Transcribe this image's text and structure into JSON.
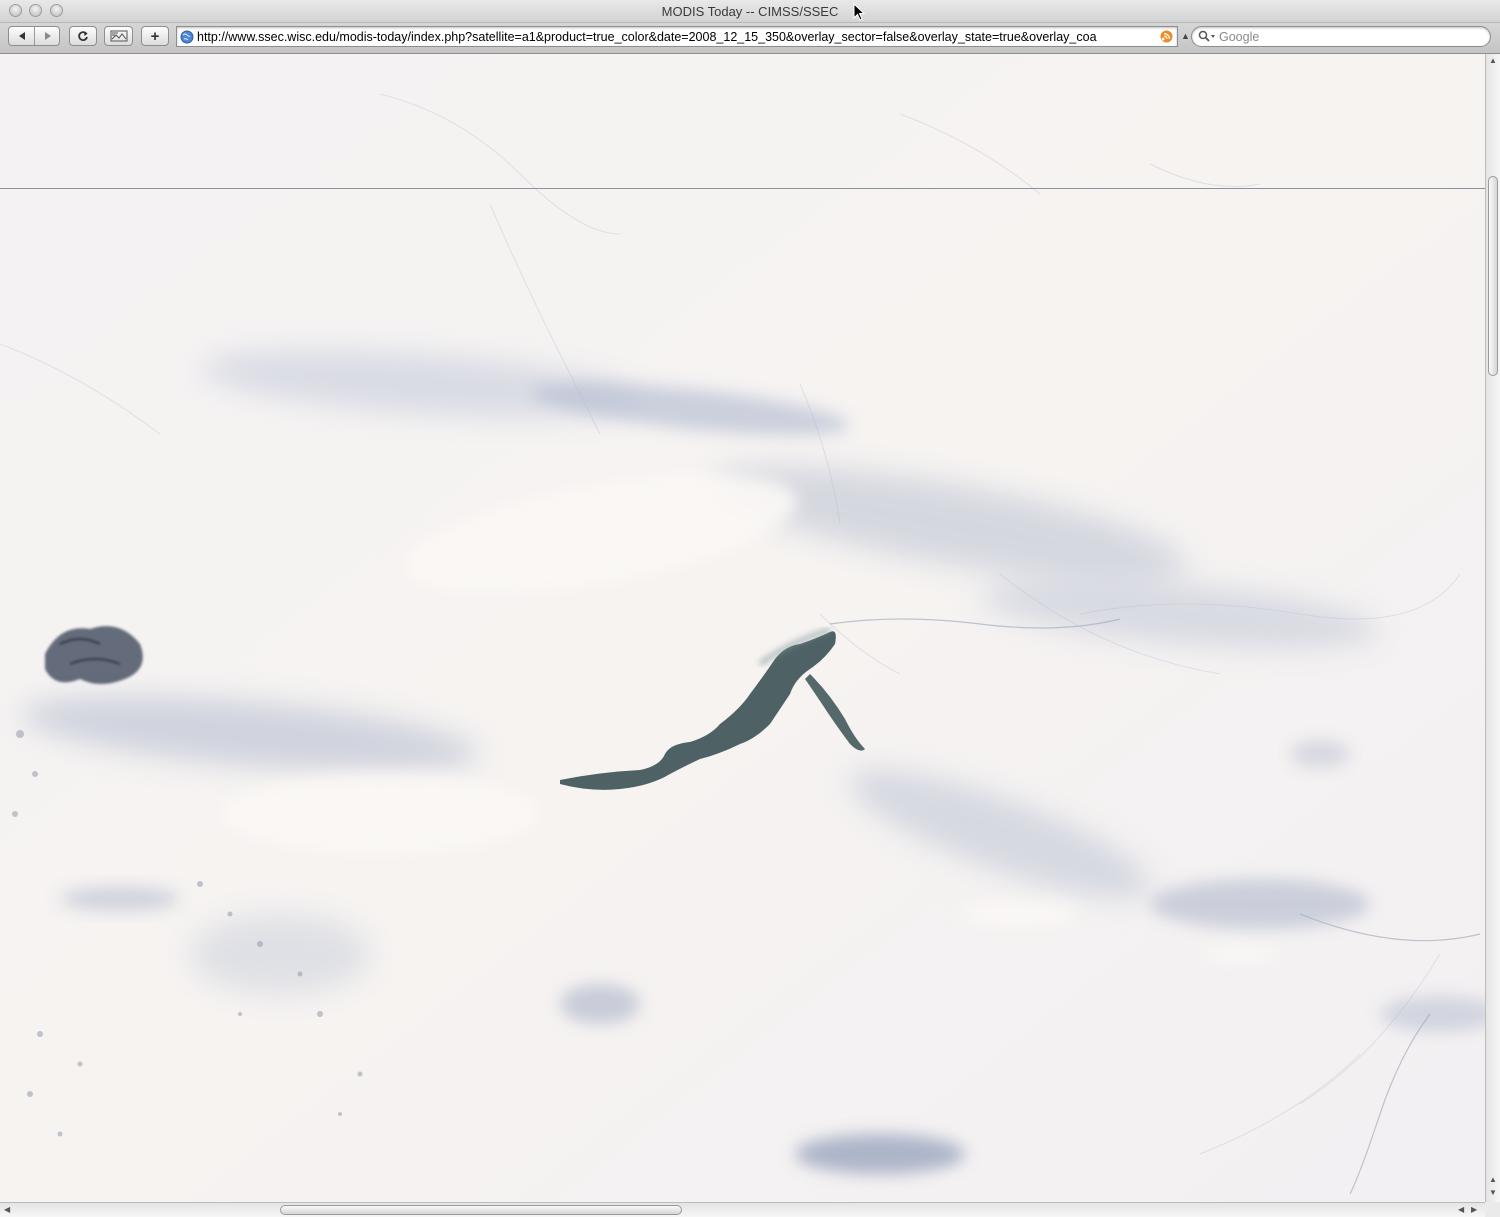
{
  "window": {
    "title": "MODIS Today -- CIMSS/SSEC"
  },
  "toolbar": {
    "back_icon": "back-arrow-icon",
    "forward_icon": "forward-arrow-icon",
    "reload_icon": "reload-icon",
    "add_bookmark_label": "+",
    "url": "http://www.ssec.wisc.edu/modis-today/index.php?satellite=a1&product=true_color&date=2008_12_15_350&overlay_sector=false&overlay_state=true&overlay_coa",
    "search_placeholder": "Google"
  },
  "colors": {
    "snow": "#f3f1f2",
    "cloud_shadow": "#a9b3cc",
    "lake_water": "#3f5558"
  }
}
